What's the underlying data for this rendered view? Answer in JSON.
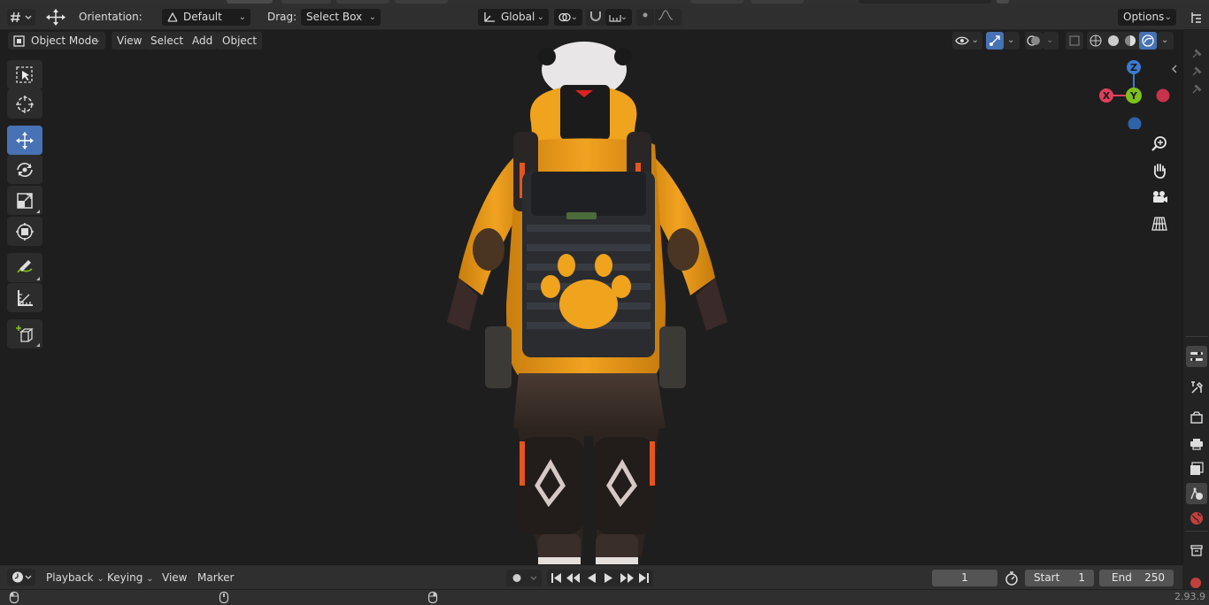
{
  "tool_settings": {
    "orientation_label": "Orientation:",
    "orientation_value": "Default",
    "drag_label": "Drag:",
    "drag_value": "Select Box",
    "transform_orientation": "Global",
    "options_label": "Options"
  },
  "viewport_header": {
    "mode": "Object Mode",
    "menus": [
      "View",
      "Select",
      "Add",
      "Object"
    ]
  },
  "toolbar": {
    "tools": [
      "select-box",
      "cursor",
      "move",
      "rotate",
      "scale",
      "transform",
      "annotate",
      "measure",
      "add-cube"
    ],
    "active_tool": "move"
  },
  "gizmo": {
    "axes": [
      "Z",
      "X",
      "Y"
    ],
    "colors": {
      "x": "#e0405a",
      "y": "#7ec11b",
      "z": "#3b7ad0"
    }
  },
  "timeline": {
    "menus": [
      "Playback",
      "Keying",
      "View",
      "Marker"
    ],
    "current_frame": "1",
    "start_label": "Start",
    "start_value": "1",
    "end_label": "End",
    "end_value": "250"
  },
  "status": {
    "version": "2.93.9"
  },
  "colors": {
    "accent": "#4772b3",
    "header": "#2f2f2f",
    "viewport": "#1e1e1e"
  }
}
